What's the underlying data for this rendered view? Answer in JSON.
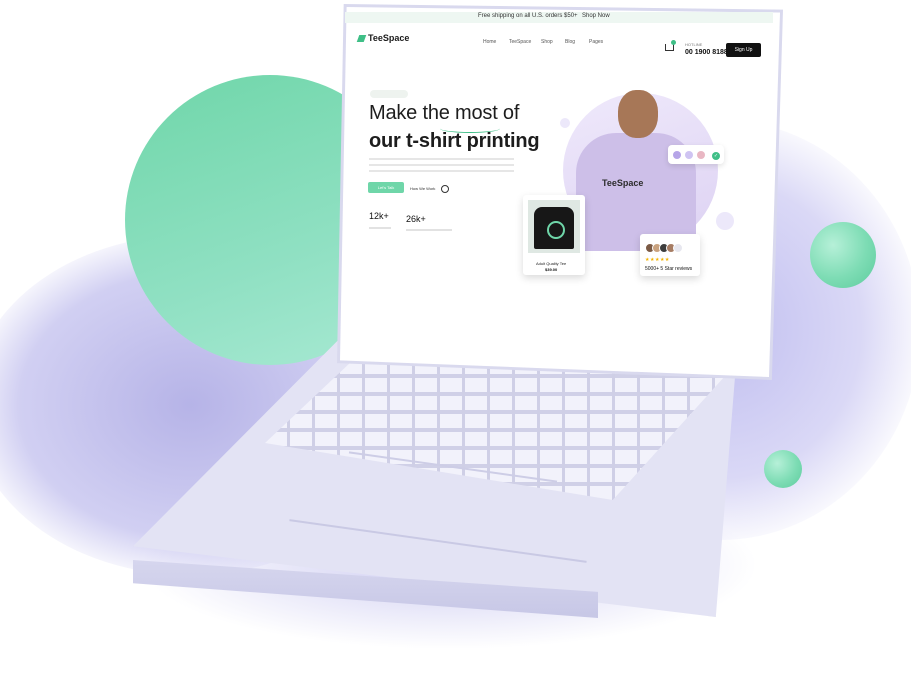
{
  "topbar": {
    "promo": "Free shipping on all U.S. orders $50+",
    "link": "Shop Now"
  },
  "header": {
    "logo": "TeeSpace",
    "nav": [
      "Home",
      "TeeSpace",
      "Shop",
      "Blog",
      "Pages"
    ],
    "hotline_label": "HOTLINE",
    "phone": "00 1900 8188",
    "signup": "Sign Up"
  },
  "hero": {
    "title_line1": "Make the most of",
    "title_line2": "our t-shirt printing",
    "cta": "Let's Talk",
    "how_it_works": "How We Work",
    "stats": [
      {
        "value": "12k+"
      },
      {
        "value": "26k+"
      }
    ],
    "hoodie_logo": "TeeSpace",
    "product": {
      "name": "Adult Quality Tee",
      "price": "$39.00"
    },
    "reviews": {
      "stars": "★★★★★",
      "text": "5000+ 5 Star reviews"
    }
  },
  "colors": {
    "accent": "#6fd6a9",
    "green_blob": "#6fd6a9",
    "lavender": "#c9c7f0",
    "swatches": [
      "#b6a5e8",
      "#cfc4f2",
      "#e9b7c3",
      "#6fd6a9"
    ]
  }
}
